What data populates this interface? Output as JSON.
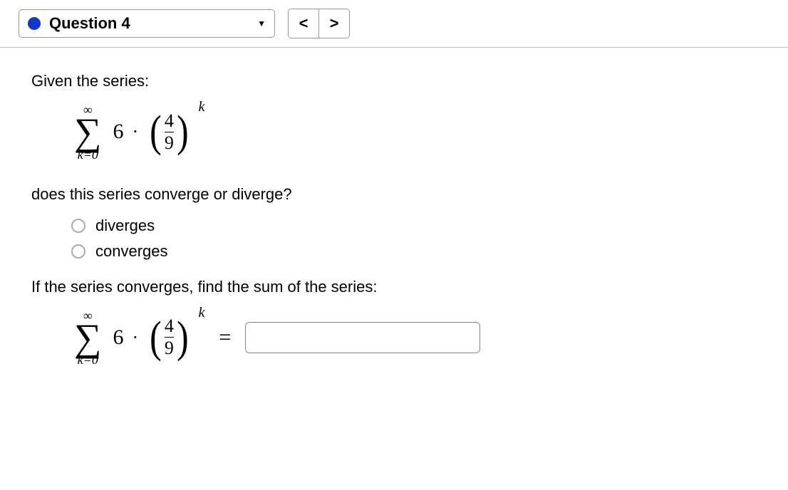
{
  "header": {
    "question_label": "Question 4",
    "prev_symbol": "<",
    "next_symbol": ">"
  },
  "prompt1": "Given the series:",
  "series": {
    "sigma_upper": "∞",
    "sigma_symbol": "∑",
    "sigma_lower_var": "k",
    "sigma_lower_eq": "=",
    "sigma_lower_val": "0",
    "coefficient": "6",
    "dot": "·",
    "frac_num": "4",
    "frac_den": "9",
    "exponent": "k"
  },
  "prompt2": "does this series converge or diverge?",
  "options": [
    {
      "label": "diverges"
    },
    {
      "label": "converges"
    }
  ],
  "prompt3": "If the series converges, find the sum of the series:",
  "equals": "=",
  "answer_value": ""
}
